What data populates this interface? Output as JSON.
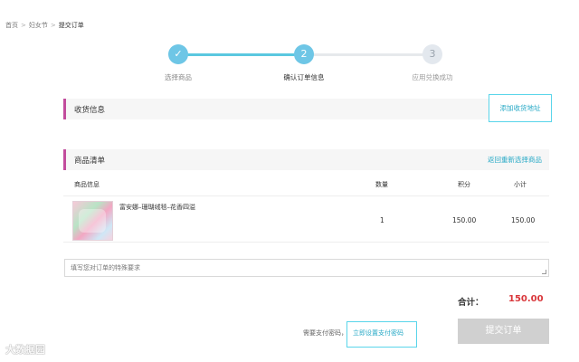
{
  "breadcrumb": {
    "items": [
      "首页",
      "妇女节"
    ],
    "separator": ">",
    "current": "提交订单"
  },
  "steps": [
    {
      "symbol": "✓",
      "label": "选择商品",
      "state": "done"
    },
    {
      "symbol": "2",
      "label": "确认订单信息",
      "state": "active"
    },
    {
      "symbol": "3",
      "label": "应用兑换成功",
      "state": "pending"
    }
  ],
  "address": {
    "title": "收货信息",
    "add_button": "添加收货地址"
  },
  "goods": {
    "title": "商品清单",
    "reselect_link": "返回重新选择商品",
    "columns": {
      "info": "商品信息",
      "qty": "数量",
      "points": "积分",
      "subtotal": "小计"
    },
    "items": [
      {
        "name": "富安娜–珊瑚绒毯–花香四溢",
        "qty": "1",
        "points": "150.00",
        "subtotal": "150.00"
      }
    ]
  },
  "remark": {
    "placeholder": "填写您对订单的特殊要求"
  },
  "total": {
    "label": "合计：",
    "value": "150.00"
  },
  "payment": {
    "hint": "需要支付密码，",
    "set_password_link": "立即设置支付密码"
  },
  "submit_label": "提交订单",
  "watermark": "大数据园",
  "colors": {
    "accent": "#5bc8e0",
    "link": "#27a9c6",
    "section_marker": "#c24c9d",
    "price": "#d9373b",
    "submit_disabled": "#d0d0d0"
  }
}
